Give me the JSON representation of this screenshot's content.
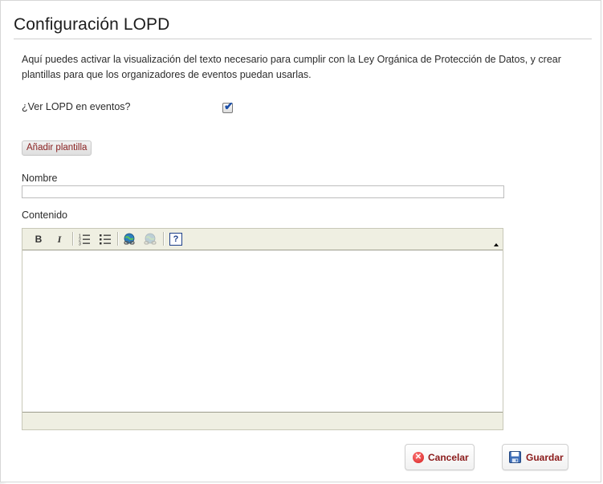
{
  "page": {
    "title": "Configuración LOPD",
    "description": "Aquí puedes activar la visualización del texto necesario para cumplir con la Ley Orgánica de Protección de Datos, y crear plantillas para que los organizadores de eventos puedan usarlas."
  },
  "lopd": {
    "label": "¿Ver LOPD en eventos?",
    "checked": true
  },
  "template": {
    "add_button": "Añadir plantilla",
    "name_label": "Nombre",
    "name_value": "",
    "content_label": "Contenido"
  },
  "editor": {
    "tools": [
      "bold-icon",
      "italic-icon",
      "numbered-list-icon",
      "bulleted-list-icon",
      "link-icon",
      "unlink-icon",
      "help-icon"
    ],
    "bold_glyph": "B",
    "italic_glyph": "I",
    "help_glyph": "?"
  },
  "actions": {
    "cancel_label": "Cancelar",
    "save_label": "Guardar"
  },
  "colors": {
    "button_text": "#8b1a1a",
    "toolbar_bg": "#efefe2"
  }
}
